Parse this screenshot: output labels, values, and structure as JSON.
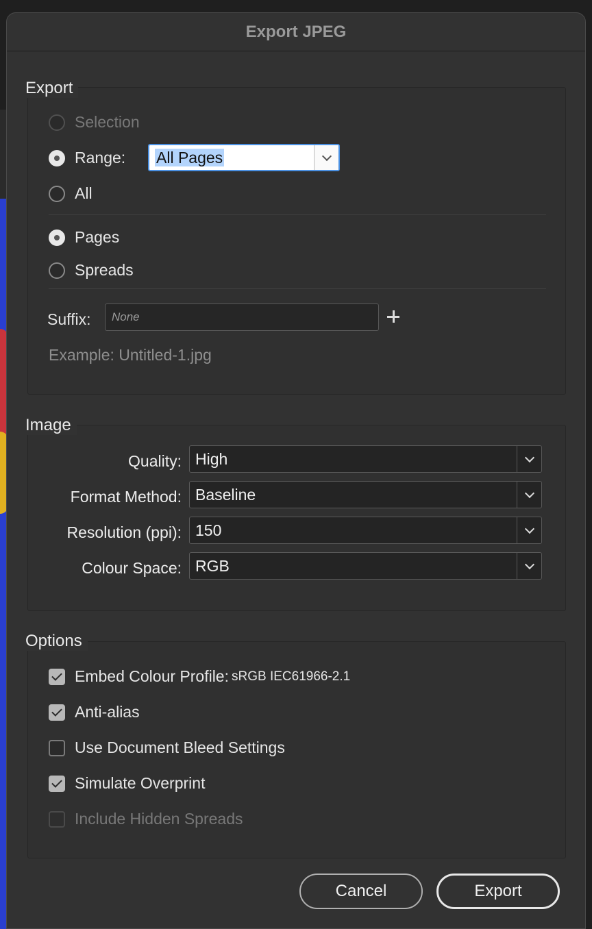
{
  "dialog": {
    "title": "Export JPEG"
  },
  "export": {
    "title": "Export",
    "selection_label": "Selection",
    "range_label": "Range:",
    "range_value": "All Pages",
    "all_label": "All",
    "pages_label": "Pages",
    "spreads_label": "Spreads",
    "suffix_label": "Suffix:",
    "suffix_placeholder": "None",
    "example_text": "Example:  Untitled-1.jpg"
  },
  "image": {
    "title": "Image",
    "quality_label": "Quality:",
    "quality_value": "High",
    "format_label": "Format Method:",
    "format_value": "Baseline",
    "resolution_label": "Resolution (ppi):",
    "resolution_value": "150",
    "colour_label": "Colour Space:",
    "colour_value": "RGB"
  },
  "options": {
    "title": "Options",
    "embed_label": "Embed Colour Profile:",
    "embed_profile": "sRGB IEC61966-2.1",
    "antialias_label": "Anti-alias",
    "bleed_label": "Use Document Bleed Settings",
    "overprint_label": "Simulate Overprint",
    "hidden_label": "Include Hidden Spreads"
  },
  "buttons": {
    "cancel": "Cancel",
    "export": "Export"
  }
}
